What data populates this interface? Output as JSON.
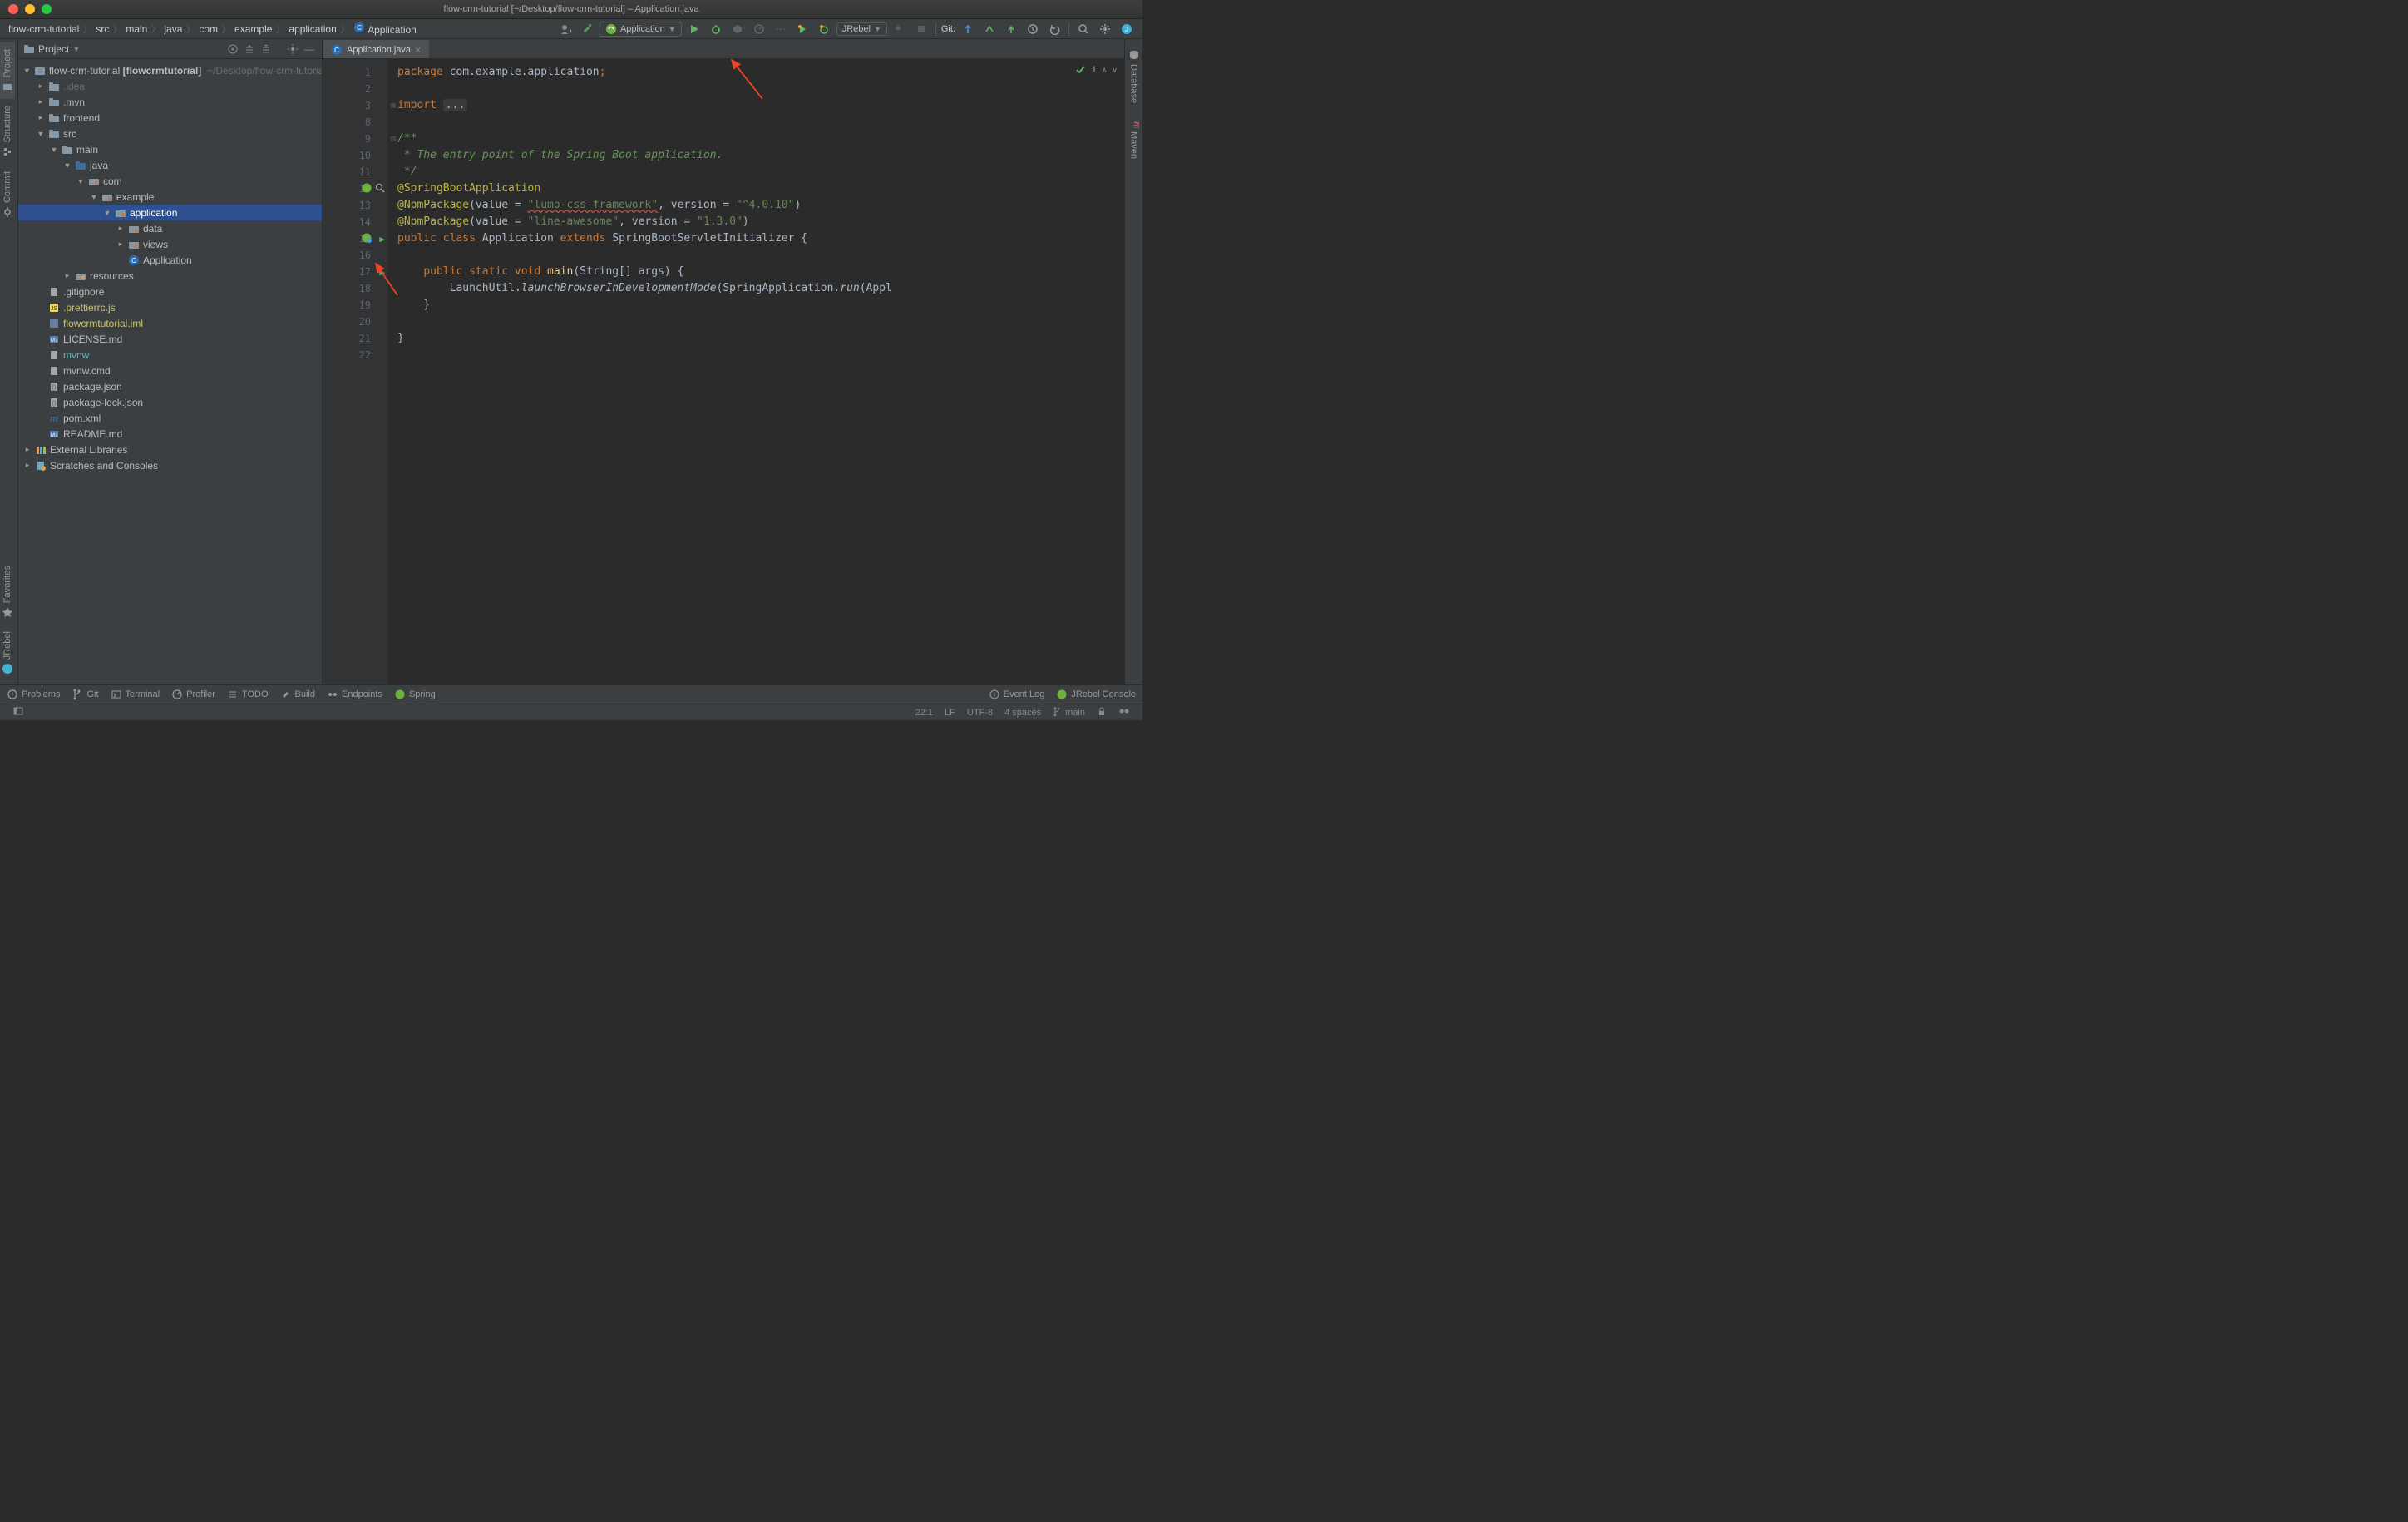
{
  "title": "flow-crm-tutorial [~/Desktop/flow-crm-tutorial] – Application.java",
  "breadcrumb": [
    "flow-crm-tutorial",
    "src",
    "main",
    "java",
    "com",
    "example",
    "application",
    "Application"
  ],
  "runConfig": "Application",
  "git": "Git:",
  "sidebar": {
    "title": "Project",
    "root": {
      "name": "flow-crm-tutorial",
      "hint": "[flowcrmtutorial]",
      "path": "~/Desktop/flow-crm-tutorial"
    },
    "items": [
      {
        "name": ".idea",
        "depth": 1,
        "arr": "r",
        "icon": "folder",
        "muted": true
      },
      {
        "name": ".mvn",
        "depth": 1,
        "arr": "r",
        "icon": "folder"
      },
      {
        "name": "frontend",
        "depth": 1,
        "arr": "r",
        "icon": "folder"
      },
      {
        "name": "src",
        "depth": 1,
        "arr": "d",
        "icon": "folder"
      },
      {
        "name": "main",
        "depth": 2,
        "arr": "d",
        "icon": "folder"
      },
      {
        "name": "java",
        "depth": 3,
        "arr": "d",
        "icon": "srcroot"
      },
      {
        "name": "com",
        "depth": 4,
        "arr": "d",
        "icon": "pkg"
      },
      {
        "name": "example",
        "depth": 5,
        "arr": "d",
        "icon": "pkg"
      },
      {
        "name": "application",
        "depth": 6,
        "arr": "d",
        "icon": "pkg",
        "sel": true
      },
      {
        "name": "data",
        "depth": 7,
        "arr": "r",
        "icon": "pkg"
      },
      {
        "name": "views",
        "depth": 7,
        "arr": "r",
        "icon": "pkg"
      },
      {
        "name": "Application",
        "depth": 7,
        "arr": "n",
        "icon": "class"
      },
      {
        "name": "resources",
        "depth": 3,
        "arr": "r",
        "icon": "resroot"
      },
      {
        "name": ".gitignore",
        "depth": 1,
        "arr": "n",
        "icon": "txt"
      },
      {
        "name": ".prettierrc.js",
        "depth": 1,
        "arr": "n",
        "icon": "js",
        "col": "yellow"
      },
      {
        "name": "flowcrmtutorial.iml",
        "depth": 1,
        "arr": "n",
        "icon": "iml",
        "col": "yellow"
      },
      {
        "name": "LICENSE.md",
        "depth": 1,
        "arr": "n",
        "icon": "md"
      },
      {
        "name": "mvnw",
        "depth": 1,
        "arr": "n",
        "icon": "txt",
        "col": "cyan"
      },
      {
        "name": "mvnw.cmd",
        "depth": 1,
        "arr": "n",
        "icon": "txt"
      },
      {
        "name": "package.json",
        "depth": 1,
        "arr": "n",
        "icon": "json"
      },
      {
        "name": "package-lock.json",
        "depth": 1,
        "arr": "n",
        "icon": "json"
      },
      {
        "name": "pom.xml",
        "depth": 1,
        "arr": "n",
        "icon": "maven"
      },
      {
        "name": "README.md",
        "depth": 1,
        "arr": "n",
        "icon": "md"
      }
    ],
    "extLib": "External Libraries",
    "scratch": "Scratches and Consoles"
  },
  "leftTabs": {
    "top": [
      "Project",
      "Structure",
      "Commit"
    ],
    "bottom": [
      "Favorites",
      "JRebel"
    ]
  },
  "rightTabs": [
    "Database",
    "Maven"
  ],
  "tab": "Application.java",
  "gutter": {
    "1": "1",
    "2": "2",
    "3": "3",
    "8": "8",
    "9": "9",
    "10": "10",
    "11": "11",
    "12": "12",
    "13": "13",
    "14": "14",
    "15": "15",
    "16": "16",
    "17": "17",
    "18": "18",
    "19": "19",
    "20": "20",
    "21": "21",
    "22": "22"
  },
  "code": {
    "pkg1": "package",
    "pkg2": "com.example.application",
    "imp1": "import",
    "imp2": "...",
    "c1": "/**",
    "c2": " * The entry point of the Spring Boot application.",
    "c3": " */",
    "ann1": "@SpringBootApplication",
    "ann2a": "@NpmPackage",
    "ann2b": "(value = ",
    "ann2c": "\"lumo-css-framework\"",
    "ann2d": ", version = ",
    "ann2e": "\"^4.0.10\"",
    "ann2f": ")",
    "ann3a": "@NpmPackage",
    "ann3b": "(value = ",
    "ann3c": "\"line-awesome\"",
    "ann3d": ", version = ",
    "ann3e": "\"1.3.0\"",
    "ann3f": ")",
    "cls1": "public class",
    "cls2": "Application",
    "cls3": "extends",
    "cls4": "SpringBootServletInitializer {",
    "m1": "public static void",
    "m2": "main",
    "m3": "(String[] args) {",
    "body": "LaunchUtil.",
    "body2": "launchBrowserInDevelopmentMode",
    "body3": "(SpringApplication.",
    "body4": "run",
    "body5": "(Appl",
    "cb1": "}",
    "cb2": "}"
  },
  "inspection": {
    "count": "1"
  },
  "bottom": {
    "problems": "Problems",
    "git": "Git",
    "terminal": "Terminal",
    "profiler": "Profiler",
    "todo": "TODO",
    "build": "Build",
    "endpoints": "Endpoints",
    "spring": "Spring",
    "eventlog": "Event Log",
    "jrebel": "JRebel Console"
  },
  "status": {
    "pos": "22:1",
    "lf": "LF",
    "enc": "UTF-8",
    "indent": "4 spaces",
    "branch": "main"
  }
}
